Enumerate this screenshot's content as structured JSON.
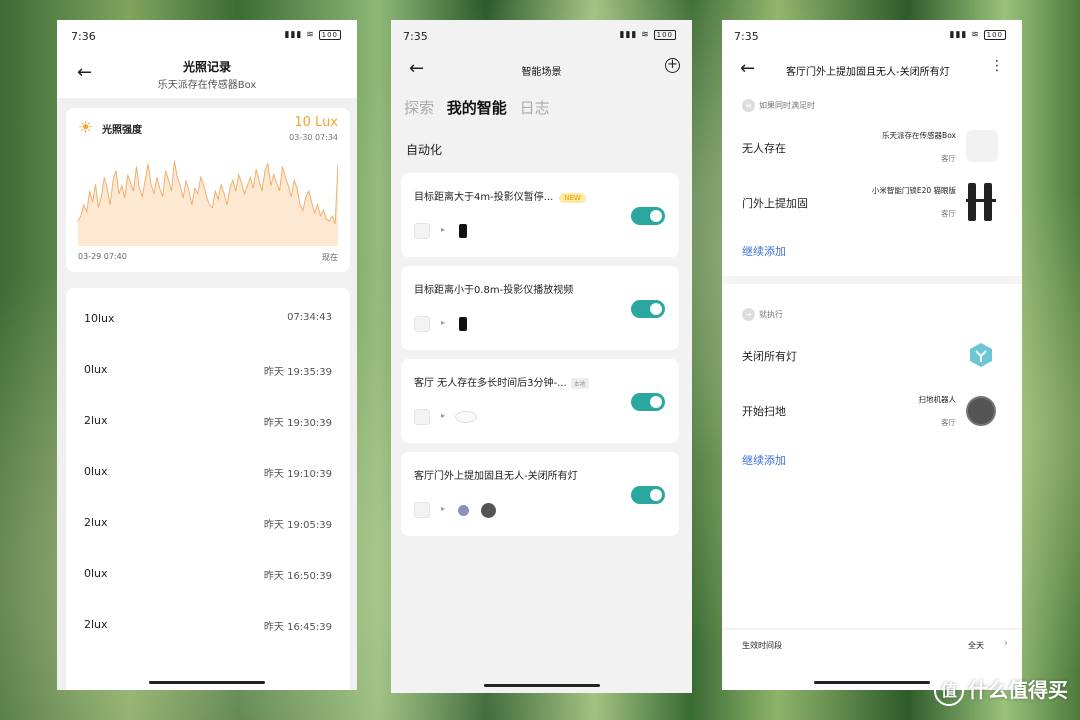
{
  "phone1": {
    "status_time": "7:36",
    "battery": "100",
    "title": "光照记录",
    "subtitle": "乐天派存在传感器Box",
    "card": {
      "label": "光照强度",
      "value": "10 Lux",
      "timestamp": "03-30 07:34",
      "x_start": "03-29 07:40",
      "x_end": "现在"
    },
    "records": [
      {
        "value": "10lux",
        "time": "07:34:43"
      },
      {
        "value": "0lux",
        "time": "昨天 19:35:39"
      },
      {
        "value": "2lux",
        "time": "昨天 19:30:39"
      },
      {
        "value": "0lux",
        "time": "昨天 19:10:39"
      },
      {
        "value": "2lux",
        "time": "昨天 19:05:39"
      },
      {
        "value": "0lux",
        "time": "昨天 16:50:39"
      },
      {
        "value": "2lux",
        "time": "昨天 16:45:39"
      }
    ],
    "chart_color": "#f0b070"
  },
  "chart_data": {
    "type": "area",
    "title": "光照强度",
    "xlabel": "",
    "ylabel": "",
    "x_range": [
      "03-29 07:40",
      "现在"
    ],
    "values": [
      18,
      22,
      30,
      25,
      40,
      32,
      45,
      28,
      36,
      50,
      42,
      30,
      48,
      55,
      38,
      44,
      35,
      52,
      46,
      40,
      58,
      42,
      36,
      48,
      60,
      45,
      38,
      50,
      42,
      36,
      55,
      48,
      40,
      62,
      50,
      44,
      35,
      48,
      40,
      30,
      42,
      38,
      50,
      45,
      36,
      30,
      28,
      40,
      34,
      45,
      38,
      30,
      42,
      48,
      40,
      52,
      46,
      38,
      44,
      50,
      42,
      56,
      48,
      40,
      55,
      60,
      44,
      52,
      46,
      40,
      58,
      50,
      44,
      36,
      48,
      42,
      30,
      26,
      36,
      40,
      32,
      24,
      30,
      22,
      26,
      20,
      18,
      22,
      16,
      60
    ]
  },
  "phone2": {
    "status_time": "7:35",
    "battery": "100",
    "title": "智能场景",
    "tabs": [
      "探索",
      "我的智能",
      "日志"
    ],
    "section": "自动化",
    "scenes": [
      {
        "name": "目标距离大于4m-投影仪暂停...",
        "badge": "NEW",
        "enabled": true
      },
      {
        "name": "目标距离小于0.8m-投影仪播放视频",
        "enabled": true
      },
      {
        "name": "客厅 无人存在多长时间后3分钟-...",
        "badge": "本地",
        "enabled": true
      },
      {
        "name": "客厅门外上提加固且无人-关闭所有灯",
        "enabled": true
      }
    ]
  },
  "phone3": {
    "status_time": "7:35",
    "battery": "100",
    "title": "客厅门外上提加固且无人-关闭所有灯",
    "if_header": "如果同时满足时",
    "conditions": [
      {
        "label": "无人存在",
        "device": "乐天派存在传感器Box",
        "room": "客厅"
      },
      {
        "label": "门外上提加固",
        "device": "小米智能门锁E20 猫眼版",
        "room": "客厅"
      }
    ],
    "add_link": "继续添加",
    "then_header": "就执行",
    "actions": [
      {
        "label": "关闭所有灯"
      },
      {
        "label": "开始扫地",
        "device": "扫地机器人",
        "room": "客厅"
      }
    ],
    "add_link2": "继续添加",
    "effective_label": "生效时间段",
    "effective_value": "全天"
  },
  "watermark": "什么值得买",
  "colors": {
    "toggle_on": "#2aa8a0",
    "link": "#3a6fd8",
    "accent_orange": "#f0a830"
  }
}
